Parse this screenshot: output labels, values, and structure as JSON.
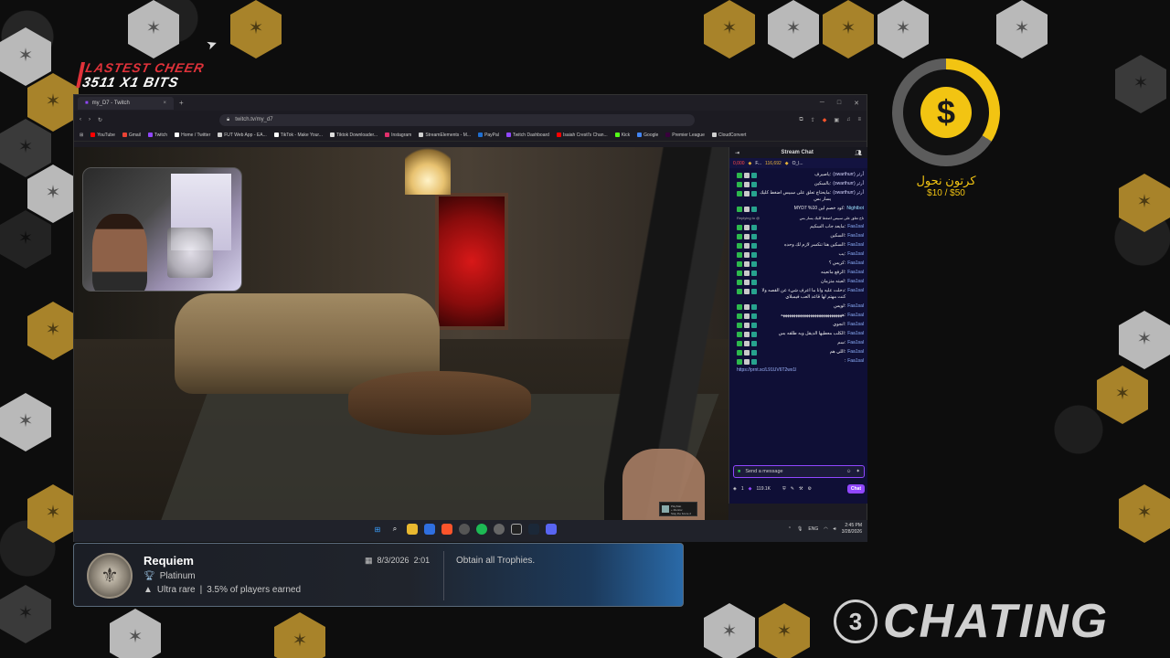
{
  "cheer": {
    "title": "LASTEST CHEER",
    "amount": "3511 X1 BITS"
  },
  "browser": {
    "tab_title": "my_D7 - Twitch",
    "url": "twitch.tv/my_d7",
    "bookmarks": [
      {
        "label": "YouTube",
        "color": "#ff0000"
      },
      {
        "label": "Gmail",
        "color": "#ea4335"
      },
      {
        "label": "Twitch",
        "color": "#9147ff"
      },
      {
        "label": "Home / Twitter",
        "color": "#ffffff"
      },
      {
        "label": "FUT Web App - EA...",
        "color": "#cfcfcf"
      },
      {
        "label": "TikTok - Make Your...",
        "color": "#ffffff"
      },
      {
        "label": "Tiktok Downloader...",
        "color": "#dddddd"
      },
      {
        "label": "Instagram",
        "color": "#e1306c"
      },
      {
        "label": "StreamElements - M...",
        "color": "#cfcfcf"
      },
      {
        "label": "PayPal",
        "color": "#1f6fd1"
      },
      {
        "label": "Twitch Dashboard",
        "color": "#9147ff"
      },
      {
        "label": "Isaiah Crestl's Chan...",
        "color": "#ff0000"
      },
      {
        "label": "Kick",
        "color": "#53fc18"
      },
      {
        "label": "Google",
        "color": "#4285f4"
      },
      {
        "label": "Premier League",
        "color": "#38003c"
      },
      {
        "label": "CloudConvert",
        "color": "#cfcfcf"
      }
    ]
  },
  "chat": {
    "title": "Stream Chat",
    "pins": {
      "left": "0,000",
      "user1": "F...",
      "count": "116,692",
      "user2": "O_l..."
    },
    "messages": [
      {
        "name": "(owarthurr) أرثر",
        "text": ":ياصيرف",
        "style": "owarth"
      },
      {
        "name": "(owarthurr) أرثر",
        "text": ":بالسكين",
        "style": "owarth"
      },
      {
        "name": "(owarthurr) أرثر",
        "text": ":مايحتاج تعلق على سبيس اضغط كليك يسار بس",
        "style": "owarth"
      },
      {
        "name": "Nightbot",
        "text": ":كود خصم لين 10% MYD7",
        "style": "bot"
      },
      {
        "name": "Replying to @",
        "text": "تاح تعلق على سبيس اضغط كليك يسار بس",
        "style": "reply"
      },
      {
        "name": "Faa1sal",
        "text": ":مايعد جاب السكيم",
        "style": "user"
      },
      {
        "name": "Faa1sal",
        "text": ":السكين",
        "style": "user"
      },
      {
        "name": "Faa1sal",
        "text": ":السكين هنا تنكسر لازم لك وحده",
        "style": "user"
      },
      {
        "name": "Faa1sal",
        "text": ":يب",
        "style": "user"
      },
      {
        "name": "Faa1sal",
        "text": ":كريس ؟",
        "style": "user"
      },
      {
        "name": "Faa1sal",
        "text": ":الرفع ماتعينه",
        "style": "user"
      },
      {
        "name": "Faa1sal",
        "text": ":لعبته متزمان",
        "style": "user"
      },
      {
        "name": "Faa1sal",
        "text": ":دخلت عليه وانا ما اعرف شيء عن القصه ولا كنت مهتم لها قاعد العب فيمبلاي",
        "style": "user"
      },
      {
        "name": "Faa1sal",
        "text": ":لويس",
        "style": "user"
      },
      {
        "name": "Faa1sal",
        "text": ":هههههههههههههههههههههههههههههه",
        "style": "user"
      },
      {
        "name": "Faa1sal",
        "text": ":انجوي",
        "style": "user"
      },
      {
        "name": "Faa1sal",
        "text": ":الكلب معطيها الديقل وبه طلقه بس",
        "style": "user"
      },
      {
        "name": "Faa1sal",
        "text": ":سم",
        "style": "user"
      },
      {
        "name": "Faa1sal",
        "text": ":اللي هم",
        "style": "user"
      },
      {
        "name": "Faa1sal",
        "text": ":",
        "style": "user"
      },
      {
        "name": "",
        "text": "https://prnt.sc/L91UV6T2wx1l",
        "style": "link"
      }
    ],
    "input_placeholder": "Send a message",
    "points": "1",
    "bits": "119.1K",
    "chat_button": "Chat"
  },
  "taskbar": {
    "language": "ENG",
    "time": "2:45 PM",
    "date": "3/28/2026"
  },
  "trophy": {
    "name": "Requiem",
    "grade": "Platinum",
    "rarity": "Ultra rare",
    "percent": "3.5% of players earned",
    "date": "8/3/2026",
    "time": "2:01",
    "description": "Obtain all Trophies."
  },
  "goal": {
    "title": "كرتون نحول",
    "amount": "$10 / $50",
    "progress": 0.2
  },
  "brand": {
    "number": "3",
    "name": "CHATING"
  },
  "ps_notice": {
    "line1": "PlayStat",
    "line2": "+ Monitor",
    "line3": "Stay the future 2"
  }
}
